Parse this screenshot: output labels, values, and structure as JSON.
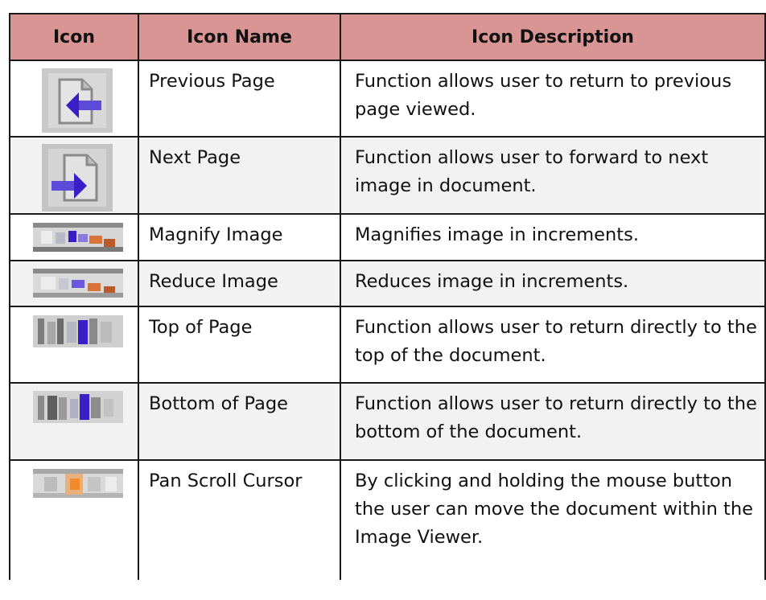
{
  "table": {
    "headers": {
      "icon": "Icon",
      "name": "Icon Name",
      "description": "Icon Description"
    },
    "rows": [
      {
        "icon": "previous-page-icon",
        "name": "Previous Page",
        "description": "Function allows user to return to previous page viewed."
      },
      {
        "icon": "next-page-icon",
        "name": "Next Page",
        "description": "Function allows user to forward to next image in document."
      },
      {
        "icon": "magnify-image-icon",
        "name": "Magnify Image",
        "description": "Magnifies image in increments."
      },
      {
        "icon": "reduce-image-icon",
        "name": "Reduce Image",
        "description": "Reduces image in increments."
      },
      {
        "icon": "top-of-page-icon",
        "name": "Top of Page",
        "description": "Function allows user to return directly to the top of the document."
      },
      {
        "icon": "bottom-of-page-icon",
        "name": "Bottom of Page",
        "description": "Function allows user to return directly to the bottom of the document."
      },
      {
        "icon": "pan-scroll-cursor-icon",
        "name": "Pan Scroll Cursor",
        "description": "By clicking and holding the mouse button the user can move the document within the Image Viewer."
      }
    ]
  },
  "colors": {
    "header_background": "#d99594",
    "shaded_row_background": "#f2f2f2",
    "icon_accent_blue": "#3a1fc9",
    "icon_accent_orange": "#d9733a"
  }
}
